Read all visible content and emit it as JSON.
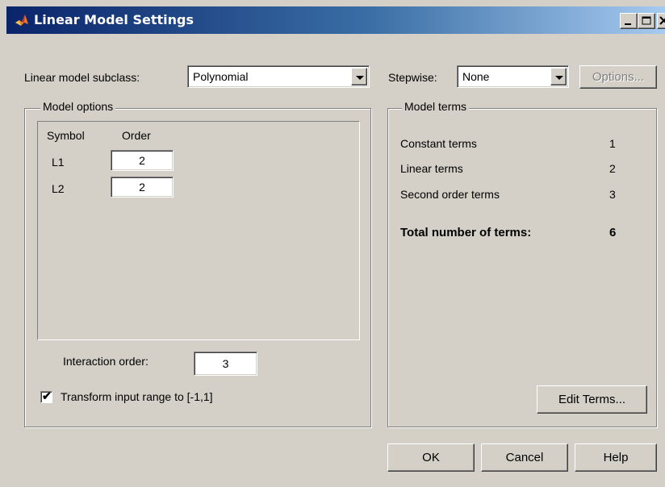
{
  "window": {
    "title": "Linear Model Settings",
    "title_icon": "matlab-logo-icon",
    "controls": {
      "minimize": "minimize-icon",
      "maximize": "maximize-icon",
      "close": "close-icon"
    }
  },
  "subclass": {
    "label": "Linear model subclass:",
    "value": "Polynomial"
  },
  "stepwise": {
    "label": "Stepwise:",
    "value": "None",
    "options_button": "Options..."
  },
  "model_options": {
    "title": "Model options",
    "headers": {
      "symbol": "Symbol",
      "order": "Order"
    },
    "rows": [
      {
        "symbol": "L1",
        "order": "2"
      },
      {
        "symbol": "L2",
        "order": "2"
      }
    ],
    "interaction_label": "Interaction order:",
    "interaction_value": "3",
    "transform_label": "Transform input range to [-1,1]",
    "transform_checked": true
  },
  "model_terms": {
    "title": "Model terms",
    "rows": [
      {
        "label": "Constant terms",
        "value": "1"
      },
      {
        "label": "Linear terms",
        "value": "2"
      },
      {
        "label": "Second order terms",
        "value": "3"
      }
    ],
    "total_label": "Total number of terms:",
    "total_value": "6",
    "edit_button": "Edit Terms..."
  },
  "buttons": {
    "ok": "OK",
    "cancel": "Cancel",
    "help": "Help"
  },
  "colors": {
    "face": "#d4d0c8",
    "title_start": "#0a246a",
    "title_end": "#a6caf0"
  }
}
